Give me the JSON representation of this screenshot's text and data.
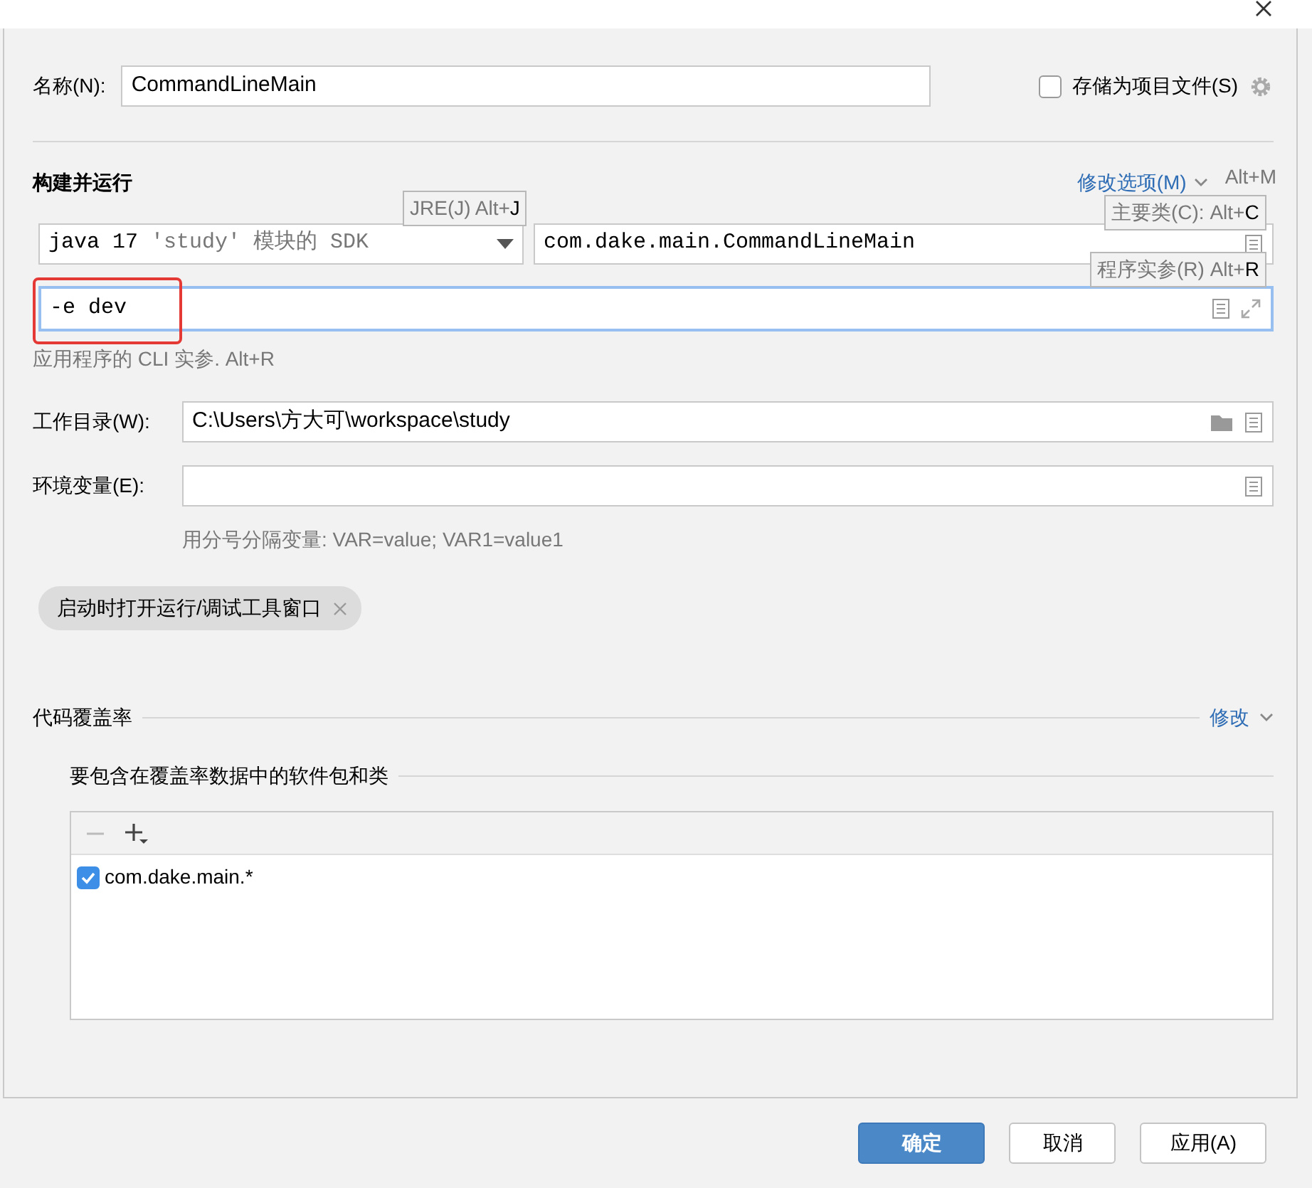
{
  "name_field": {
    "label": "名称(N):",
    "value": "CommandLineMain"
  },
  "store_as_project_file": {
    "label": "存储为项目文件(S)",
    "checked": false
  },
  "build_and_run": {
    "title": "构建并运行",
    "modify_options": "修改选项(M)",
    "modify_shortcut": "Alt+M",
    "jre": {
      "version": "java 17",
      "module": "'study'",
      "suffix": "模块的 SDK"
    },
    "main_class": "com.dake.main.CommandLineMain",
    "program_args": {
      "value": "-e dev",
      "focused": true,
      "highlighted": true
    },
    "args_hint": "应用程序的 CLI 实参. Alt+R",
    "tooltips": [
      {
        "text": "JRE(J) Alt+**J**"
      },
      {
        "text": "主要类(C): Alt+**C**"
      },
      {
        "text": "程序实参(R) Alt+**R**"
      }
    ]
  },
  "working_dir": {
    "label": "工作目录(W):",
    "value": "C:\\Users\\方大可\\workspace\\study"
  },
  "env_vars": {
    "label": "环境变量(E):",
    "hint": "用分号分隔变量: VAR=value; VAR1=value1"
  },
  "chips": [
    {
      "label": "启动时打开运行/调试工具窗口"
    }
  ],
  "coverage": {
    "title": "代码覆盖率",
    "modify": "修改",
    "subtitle": "要包含在覆盖率数据中的软件包和类",
    "items": [
      {
        "label": "com.dake.main.*",
        "checked": true
      }
    ]
  },
  "buttons": [
    {
      "label": "确定",
      "primary": true
    },
    {
      "label": "取消",
      "primary": false
    },
    {
      "label": "应用(A)",
      "primary": false
    }
  ]
}
